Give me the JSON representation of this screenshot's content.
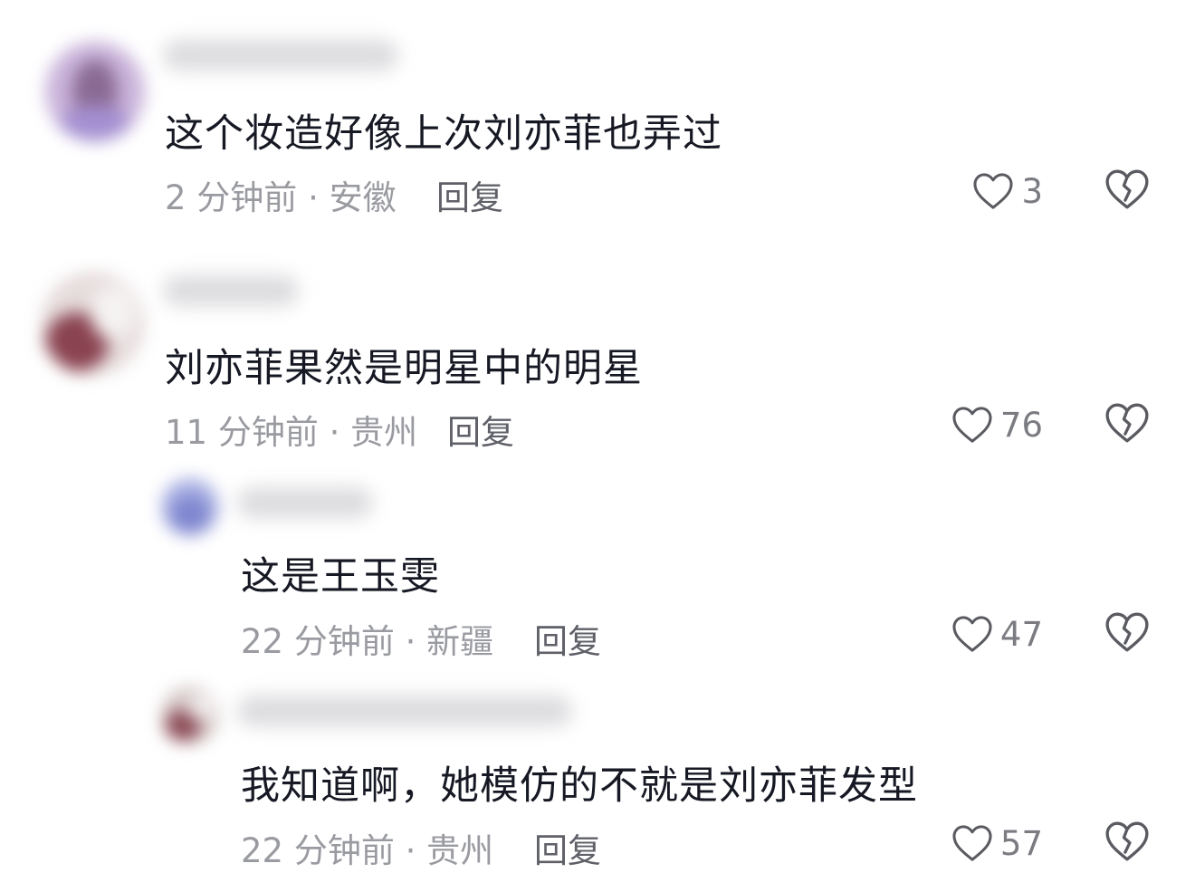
{
  "comments": [
    {
      "text": "这个妆造好像上次刘亦菲也弄过",
      "time_location": "2 分钟前 · 安徽",
      "reply_label": "回复",
      "likes": "3"
    },
    {
      "text": "刘亦菲果然是明星中的明星",
      "time_location": "11 分钟前 · 贵州",
      "reply_label": "回复",
      "likes": "76"
    },
    {
      "text": "这是王玉雯",
      "time_location": "22 分钟前 · 新疆",
      "reply_label": "回复",
      "likes": "47"
    },
    {
      "text": "我知道啊，她模仿的不就是刘亦菲发型",
      "time_location": "22 分钟前 · 贵州",
      "reply_label": "回复",
      "likes": "57"
    }
  ],
  "colors": {
    "text": "#161823",
    "meta": "#9a9ba1",
    "reply": "#5f6068",
    "icon": "#5a5b61"
  },
  "icons": {
    "like": "heart-outline-icon",
    "dislike": "broken-heart-icon"
  }
}
